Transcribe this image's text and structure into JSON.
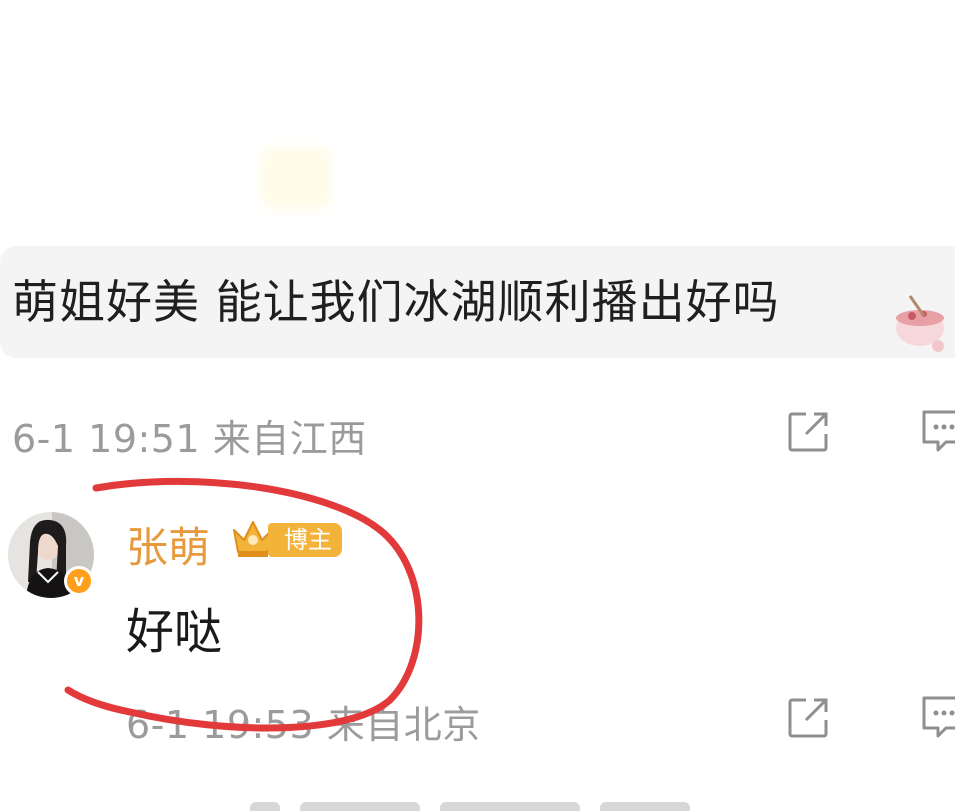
{
  "comment": {
    "text": "萌姐好美 能让我们冰湖顺利播出好吗",
    "meta": "6-1 19:51 来自江西"
  },
  "reply": {
    "username": "张萌",
    "badge_label": "博主",
    "verified_mark": "v",
    "text": "好哒",
    "meta": "6-1 19:53 来自北京"
  },
  "icons": {
    "share": "share-icon",
    "comment": "comment-icon",
    "crown": "crown-icon"
  },
  "colors": {
    "username": "#e79a3d",
    "badge": "#f3b23a",
    "meta_text": "#9b9b9b",
    "annotation_red": "#e23a3a"
  }
}
